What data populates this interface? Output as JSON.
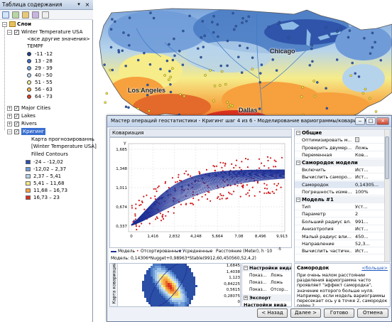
{
  "toc": {
    "title": "Таблица содержания",
    "pin": "▾",
    "close": "×",
    "root": "Слои",
    "layers": {
      "winter": "Winter Temperature USA",
      "all_other": "<все другие значения>",
      "field": "TEMPF",
      "classes": [
        {
          "label": "-11 -12",
          "color": "#1d3f8c"
        },
        {
          "label": "13 - 28",
          "color": "#3d6fc8"
        },
        {
          "label": "29 - 39",
          "color": "#77a6e0"
        },
        {
          "label": "40 - 50",
          "color": "#b9d4ec"
        },
        {
          "label": "51 - 55",
          "color": "#f2ee9e"
        },
        {
          "label": "56 - 63",
          "color": "#f6b14c"
        },
        {
          "label": "64 - 73",
          "color": "#e0402a"
        }
      ],
      "major_cities": "Major Cities",
      "lakes": "Lakes",
      "rivers": "Rivers",
      "kriging": "Кригинг",
      "kriging_sub1": "Карта прогнозированнь",
      "kriging_sub2": "[Winter Temperature USA]",
      "filled": "Filled Contours",
      "contours": [
        {
          "label": "-24 – -12,02",
          "color": "#2b4fa6"
        },
        {
          "label": "-12,02 – 2,37",
          "color": "#6f9bd8"
        },
        {
          "label": "2,37 – 5,41",
          "color": "#b6d3ec"
        },
        {
          "label": "5,41 – 11,68",
          "color": "#f6ec8a"
        },
        {
          "label": "11,68 – 16,73",
          "color": "#f6a13e"
        },
        {
          "label": "16,73 – 23",
          "color": "#d9311f"
        }
      ]
    }
  },
  "map": {
    "labels": {
      "chicago": "Chicago",
      "los_angeles": "Los Angeles",
      "dallas": "Dallas"
    }
  },
  "dialog": {
    "title": "Мастер операций геостатистики - Кригинг шаг 4 из 6 - Моделирование вариограммы/ковариации",
    "min": "‒",
    "max": "□",
    "close": "×",
    "section": "Ковариация",
    "chart_data": {
      "type": "scatter",
      "y_axis_title": "Y",
      "yticks": [
        "1,685",
        "1,348",
        "1,011",
        "0,674",
        "0,337"
      ],
      "xticks": [
        "0",
        "1,416",
        "2,832",
        "4,248",
        "5,664",
        "7,08",
        "8,496",
        "9,913"
      ],
      "x_exponent": "-5"
    },
    "legend": {
      "model": "Модель",
      "sorted": "Отсортированные",
      "averaged": "Усредненные",
      "distance": "Расстояние (Meter), h ·10"
    },
    "model_text": "Модель: 0,14306*Nugget+0,98963*Stable(9912,60,450560,52,4,2)",
    "mini": {
      "ylabel": "Карта ковариаций",
      "scale": [
        "1,6845",
        "1,4038",
        "1,123",
        "0,84225",
        "0,5615",
        "0,28075",
        "0"
      ]
    },
    "view": {
      "title": "Настройки вида",
      "rows": [
        {
          "k": "Показ...",
          "v": "Ложь"
        },
        {
          "k": "Показ...",
          "v": "Ложь"
        },
        {
          "k": "Показ...",
          "v": "Отсор..."
        }
      ],
      "export": "Экспорт",
      "footer": "Настройки вида"
    },
    "props": {
      "general": "Общие",
      "optimize_k": "Оптимизировать м...",
      "check_k": "Проверить двумер...",
      "check_v": "Ложь",
      "var_k": "Переменная",
      "var_v": "Ков...",
      "nugget": "Самородок модели",
      "enable_k": "Включить",
      "enable_v": "Ист...",
      "calc_k": "Вычислить саморо...",
      "calc_v": "Ист...",
      "nugget_k": "Самородок",
      "nugget_v": "0,14305...",
      "err_k": "Погрешность изме...",
      "err_v": "100%",
      "model1": "Модель #1",
      "type_k": "Тип",
      "type_v": "Уст...",
      "param_k": "Параметр",
      "param_v": "2",
      "major_k": "Больший радиус вл...",
      "major_v": "991...",
      "aniso_k": "Анизотропия",
      "aniso_v": "Ист...",
      "minor_k": "Малый радиус вли...",
      "minor_v": "450...",
      "dir_k": "Направление",
      "dir_v": "52,3...",
      "part_k": "Вычислить частичн...",
      "part_v": "Ист..."
    },
    "help": {
      "title": "Самородок",
      "more": "<больше>",
      "text": "При очень малом расстоянии разделения вариограмма часто проявляет \"эффект самородка\", значение которого больше нуля. Например, если модель вариограммы пересекает ось y в точке 2, самородок равен 2."
    },
    "buttons": {
      "back": "< Назад",
      "next": "Далее >",
      "finish": "Готово",
      "cancel": "Отмена"
    }
  }
}
